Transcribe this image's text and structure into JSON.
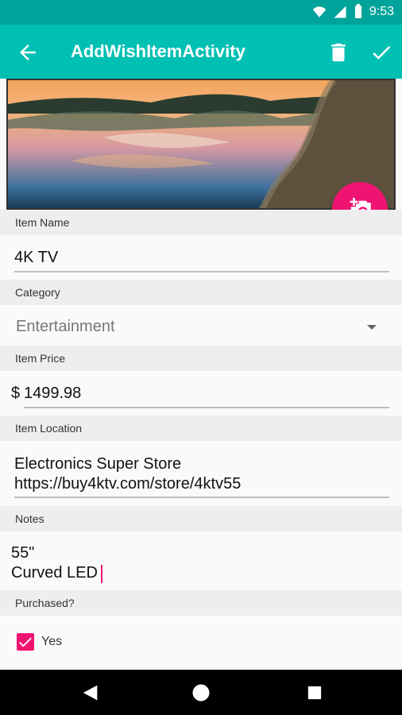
{
  "status": {
    "time": "9:53"
  },
  "appbar": {
    "title": "AddWishItemActivity"
  },
  "form": {
    "item_name": {
      "label": "Item Name",
      "value": "4K TV"
    },
    "category": {
      "label": "Category",
      "value": "Entertainment"
    },
    "price": {
      "label": "Item Price",
      "prefix": "$",
      "value": "1499.98"
    },
    "location": {
      "label": "Item Location",
      "value": "Electronics Super Store\nhttps://buy4ktv.com/store/4ktv55"
    },
    "notes": {
      "label": "Notes",
      "value": "55\"\nCurved LED"
    },
    "purchased": {
      "label": "Purchased?",
      "checkbox_label": "Yes",
      "checked": true
    }
  },
  "colors": {
    "accent": "#f01472",
    "toolbar": "#00bfb3",
    "statusbar": "#00a39a"
  },
  "icons": {
    "back": "arrow-left-icon",
    "delete": "trash-icon",
    "save": "check-icon",
    "camera": "add-photo-icon"
  }
}
